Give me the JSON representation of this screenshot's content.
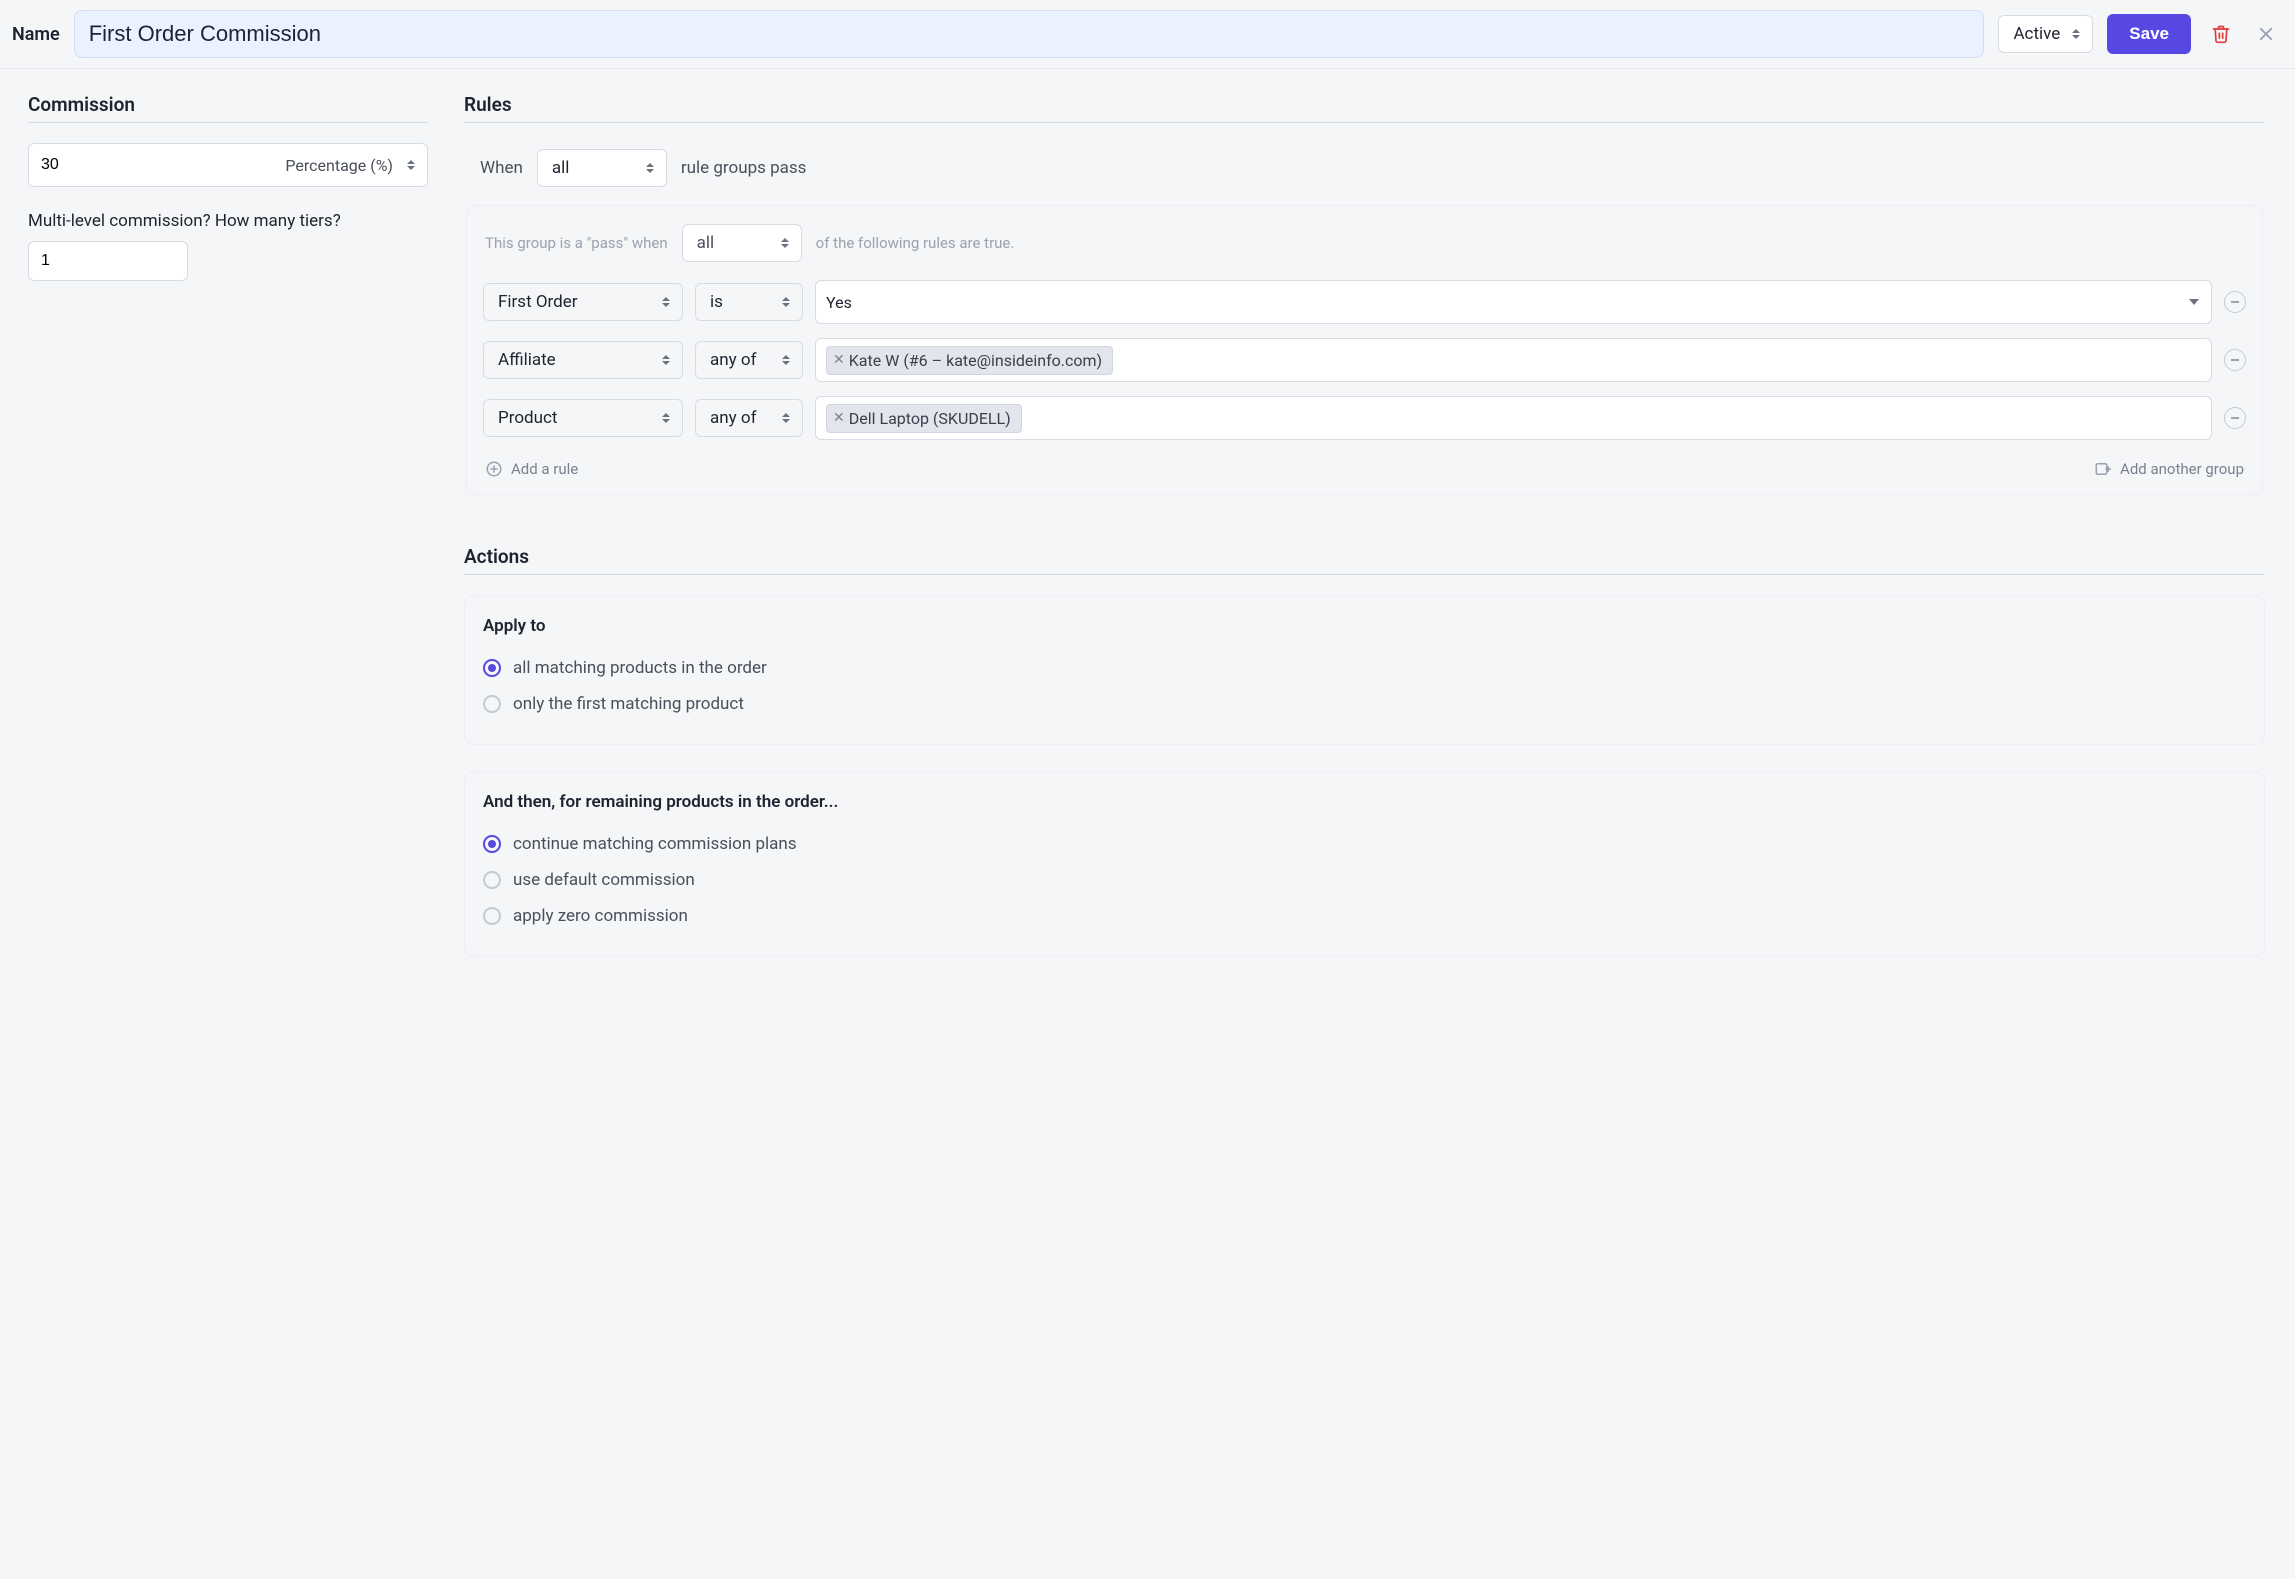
{
  "header": {
    "name_label": "Name",
    "name_value": "First Order Commission",
    "status_value": "Active",
    "save_label": "Save"
  },
  "commission": {
    "title": "Commission",
    "amount_value": "30",
    "type_value": "Percentage (%)",
    "multi_level_label": "Multi-level commission? How many tiers?",
    "tiers_value": "1"
  },
  "rules": {
    "title": "Rules",
    "when_label": "When",
    "when_select": "all",
    "when_suffix": "rule groups pass",
    "group_header_prefix": "This group is a \"pass\" when",
    "group_header_select": "all",
    "group_header_suffix": "of the following rules are true.",
    "rows": [
      {
        "field": "First Order",
        "op": "is",
        "value_type": "select",
        "value": "Yes"
      },
      {
        "field": "Affiliate",
        "op": "any of",
        "value_type": "chips",
        "chips": [
          "Kate W (#6 – kate@insideinfo.com)"
        ]
      },
      {
        "field": "Product",
        "op": "any of",
        "value_type": "chips",
        "chips": [
          "Dell Laptop (SKUDELL)"
        ]
      }
    ],
    "add_rule_label": "Add a rule",
    "add_group_label": "Add another group"
  },
  "actions": {
    "title": "Actions",
    "apply_to_heading": "Apply to",
    "apply_to_options": [
      {
        "label": "all matching products in the order",
        "checked": true
      },
      {
        "label": "only the first matching product",
        "checked": false
      }
    ],
    "remaining_heading": "And then, for remaining products in the order...",
    "remaining_options": [
      {
        "label": "continue matching commission plans",
        "checked": true
      },
      {
        "label": "use default commission",
        "checked": false
      },
      {
        "label": "apply zero commission",
        "checked": false
      }
    ]
  }
}
